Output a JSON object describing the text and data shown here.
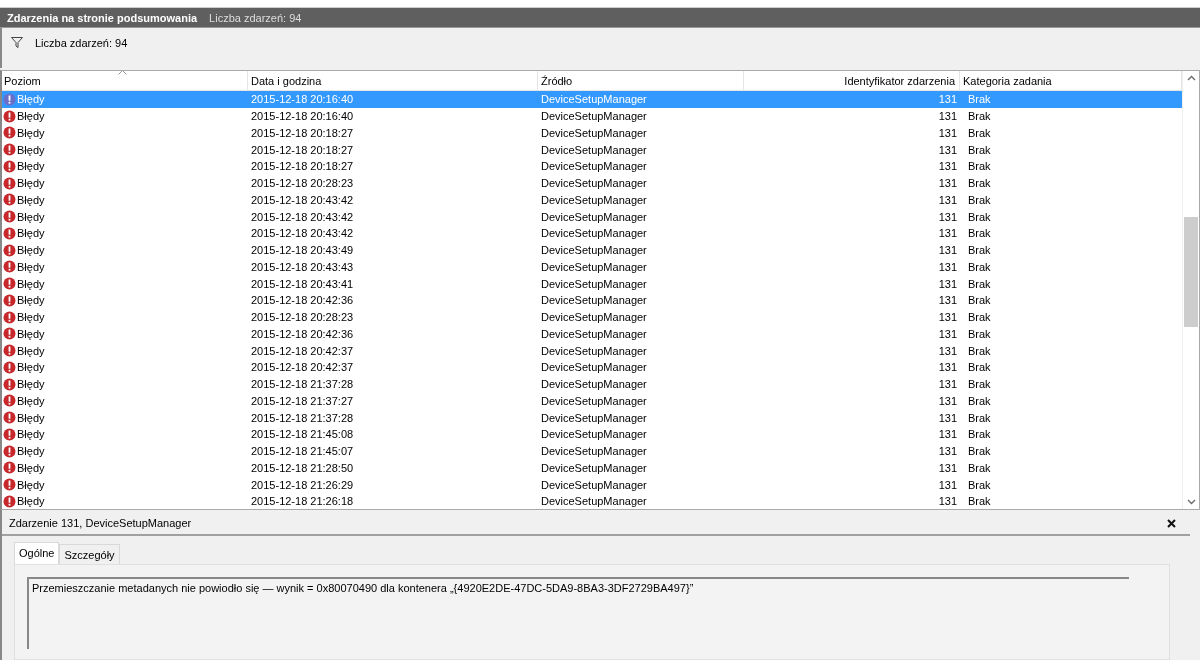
{
  "title_bar": {
    "title": "Zdarzenia na stronie podsumowania",
    "count": "Liczba zdarzeń: 94"
  },
  "filter_bar": {
    "count": "Liczba zdarzeń: 94"
  },
  "table": {
    "columns": [
      {
        "label": "Poziom",
        "sorted": true
      },
      {
        "label": "Data i godzina",
        "sorted": false
      },
      {
        "label": "Źródło",
        "sorted": false
      },
      {
        "label": "Identyfikator zdarzenia",
        "sorted": false
      },
      {
        "label": "Kategoria zadania",
        "sorted": false
      }
    ],
    "rows": [
      {
        "level": "Błędy",
        "date": "2015-12-18 20:16:40",
        "source": "DeviceSetupManager",
        "id": "131",
        "category": "Brak",
        "selected": true
      },
      {
        "level": "Błędy",
        "date": "2015-12-18 20:16:40",
        "source": "DeviceSetupManager",
        "id": "131",
        "category": "Brak",
        "selected": false
      },
      {
        "level": "Błędy",
        "date": "2015-12-18 20:18:27",
        "source": "DeviceSetupManager",
        "id": "131",
        "category": "Brak",
        "selected": false
      },
      {
        "level": "Błędy",
        "date": "2015-12-18 20:18:27",
        "source": "DeviceSetupManager",
        "id": "131",
        "category": "Brak",
        "selected": false
      },
      {
        "level": "Błędy",
        "date": "2015-12-18 20:18:27",
        "source": "DeviceSetupManager",
        "id": "131",
        "category": "Brak",
        "selected": false
      },
      {
        "level": "Błędy",
        "date": "2015-12-18 20:28:23",
        "source": "DeviceSetupManager",
        "id": "131",
        "category": "Brak",
        "selected": false
      },
      {
        "level": "Błędy",
        "date": "2015-12-18 20:43:42",
        "source": "DeviceSetupManager",
        "id": "131",
        "category": "Brak",
        "selected": false
      },
      {
        "level": "Błędy",
        "date": "2015-12-18 20:43:42",
        "source": "DeviceSetupManager",
        "id": "131",
        "category": "Brak",
        "selected": false
      },
      {
        "level": "Błędy",
        "date": "2015-12-18 20:43:42",
        "source": "DeviceSetupManager",
        "id": "131",
        "category": "Brak",
        "selected": false
      },
      {
        "level": "Błędy",
        "date": "2015-12-18 20:43:49",
        "source": "DeviceSetupManager",
        "id": "131",
        "category": "Brak",
        "selected": false
      },
      {
        "level": "Błędy",
        "date": "2015-12-18 20:43:43",
        "source": "DeviceSetupManager",
        "id": "131",
        "category": "Brak",
        "selected": false
      },
      {
        "level": "Błędy",
        "date": "2015-12-18 20:43:41",
        "source": "DeviceSetupManager",
        "id": "131",
        "category": "Brak",
        "selected": false
      },
      {
        "level": "Błędy",
        "date": "2015-12-18 20:42:36",
        "source": "DeviceSetupManager",
        "id": "131",
        "category": "Brak",
        "selected": false
      },
      {
        "level": "Błędy",
        "date": "2015-12-18 20:28:23",
        "source": "DeviceSetupManager",
        "id": "131",
        "category": "Brak",
        "selected": false
      },
      {
        "level": "Błędy",
        "date": "2015-12-18 20:42:36",
        "source": "DeviceSetupManager",
        "id": "131",
        "category": "Brak",
        "selected": false
      },
      {
        "level": "Błędy",
        "date": "2015-12-18 20:42:37",
        "source": "DeviceSetupManager",
        "id": "131",
        "category": "Brak",
        "selected": false
      },
      {
        "level": "Błędy",
        "date": "2015-12-18 20:42:37",
        "source": "DeviceSetupManager",
        "id": "131",
        "category": "Brak",
        "selected": false
      },
      {
        "level": "Błędy",
        "date": "2015-12-18 21:37:28",
        "source": "DeviceSetupManager",
        "id": "131",
        "category": "Brak",
        "selected": false
      },
      {
        "level": "Błędy",
        "date": "2015-12-18 21:37:27",
        "source": "DeviceSetupManager",
        "id": "131",
        "category": "Brak",
        "selected": false
      },
      {
        "level": "Błędy",
        "date": "2015-12-18 21:37:28",
        "source": "DeviceSetupManager",
        "id": "131",
        "category": "Brak",
        "selected": false
      },
      {
        "level": "Błędy",
        "date": "2015-12-18 21:45:08",
        "source": "DeviceSetupManager",
        "id": "131",
        "category": "Brak",
        "selected": false
      },
      {
        "level": "Błędy",
        "date": "2015-12-18 21:45:07",
        "source": "DeviceSetupManager",
        "id": "131",
        "category": "Brak",
        "selected": false
      },
      {
        "level": "Błędy",
        "date": "2015-12-18 21:28:50",
        "source": "DeviceSetupManager",
        "id": "131",
        "category": "Brak",
        "selected": false
      },
      {
        "level": "Błędy",
        "date": "2015-12-18 21:26:29",
        "source": "DeviceSetupManager",
        "id": "131",
        "category": "Brak",
        "selected": false
      },
      {
        "level": "Błędy",
        "date": "2015-12-18 21:26:18",
        "source": "DeviceSetupManager",
        "id": "131",
        "category": "Brak",
        "selected": false
      }
    ]
  },
  "detail": {
    "title": "Zdarzenie 131, DeviceSetupManager",
    "tabs": [
      {
        "label": "Ogólne",
        "selected": true
      },
      {
        "label": "Szczegóły",
        "selected": false
      }
    ],
    "message": "Przemieszczanie metadanych nie powiodło się — wynik = 0x80070490 dla kontenera „{4920E2DE-47DC-5DA9-8BA3-3DF2729BA497}”"
  }
}
